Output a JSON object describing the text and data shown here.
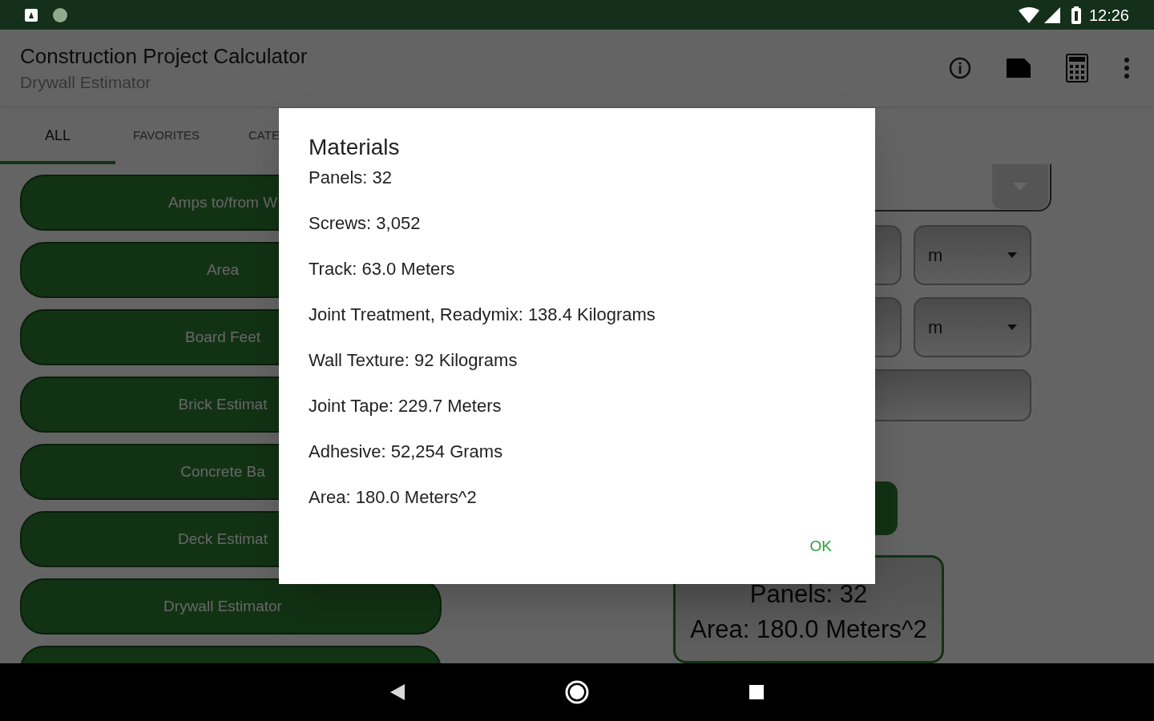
{
  "status_bar": {
    "time": "12:26"
  },
  "app_bar": {
    "title": "Construction Project Calculator",
    "subtitle": "Drywall Estimator"
  },
  "tabs": [
    {
      "label": "ALL",
      "selected": true
    },
    {
      "label": "FAVORITES",
      "selected": false
    },
    {
      "label": "CATE",
      "selected": false
    }
  ],
  "calculators": [
    "Amps to/from W",
    "Area",
    "Board Feet",
    "Brick Estimat",
    "Concrete Ba",
    "Deck Estimat",
    "Drywall Estimator"
  ],
  "form": {
    "units": [
      "m",
      "m"
    ]
  },
  "results": [
    "Panels: 32",
    "Area: 180.0 Meters^2"
  ],
  "dialog": {
    "title": "Materials",
    "lines": [
      "Panels: 32",
      "Screws: 3,052",
      "Track: 63.0 Meters",
      "Joint Treatment, Readymix: 138.4 Kilograms",
      "Wall Texture: 92 Kilograms",
      "Joint Tape: 229.7 Meters",
      "Adhesive: 52,254 Grams",
      "Area: 180.0 Meters^2"
    ],
    "ok": "OK"
  }
}
